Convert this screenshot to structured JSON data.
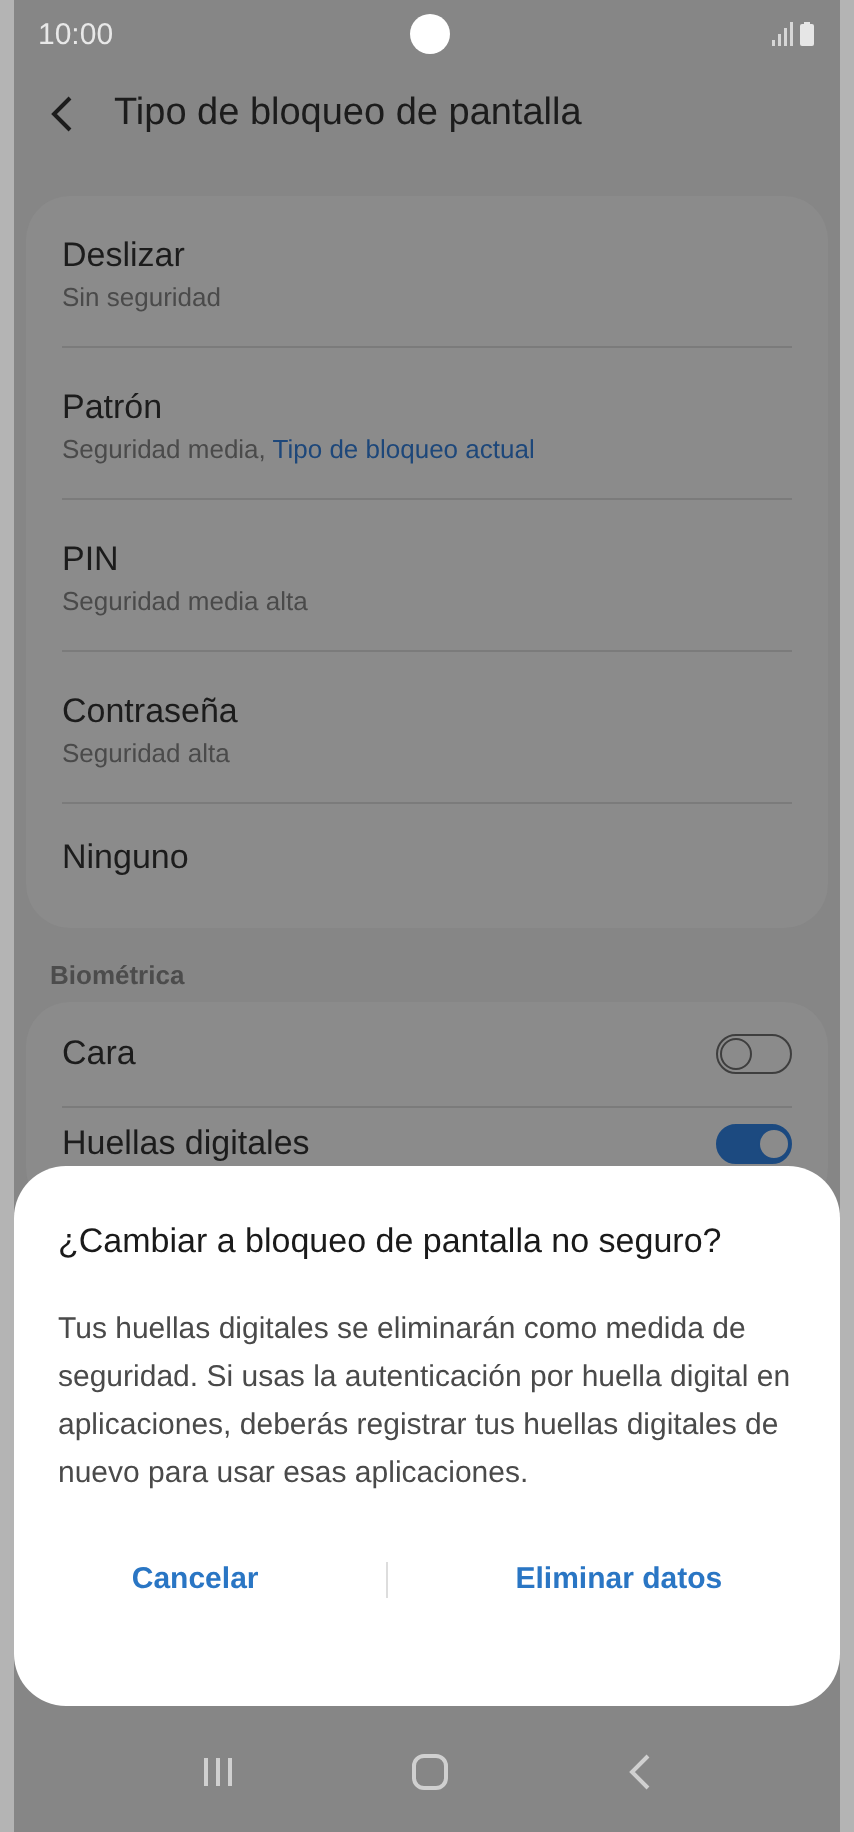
{
  "status_bar": {
    "time": "10:00"
  },
  "header": {
    "title": "Tipo de bloqueo de pantalla"
  },
  "lock_types": [
    {
      "title": "Deslizar",
      "subtitle": "Sin seguridad"
    },
    {
      "title": "Patrón",
      "subtitle": "Seguridad media, ",
      "link": "Tipo de bloqueo actual"
    },
    {
      "title": "PIN",
      "subtitle": "Seguridad media alta"
    },
    {
      "title": "Contraseña",
      "subtitle": "Seguridad alta"
    },
    {
      "title": "Ninguno"
    }
  ],
  "biometrics": {
    "heading": "Biométrica",
    "items": [
      {
        "title": "Cara",
        "on": false
      },
      {
        "title": "Huellas digitales",
        "on": true
      }
    ]
  },
  "dialog": {
    "title": "¿Cambiar a bloqueo de pantalla no seguro?",
    "message": "Tus huellas digitales se eliminarán como medida de seguridad. Si usas la autenticación por huella digital en aplicaciones, deberás registrar tus huellas digitales de nuevo para usar esas aplicaciones.",
    "buttons": [
      "Cancelar",
      "Eliminar datos"
    ]
  }
}
